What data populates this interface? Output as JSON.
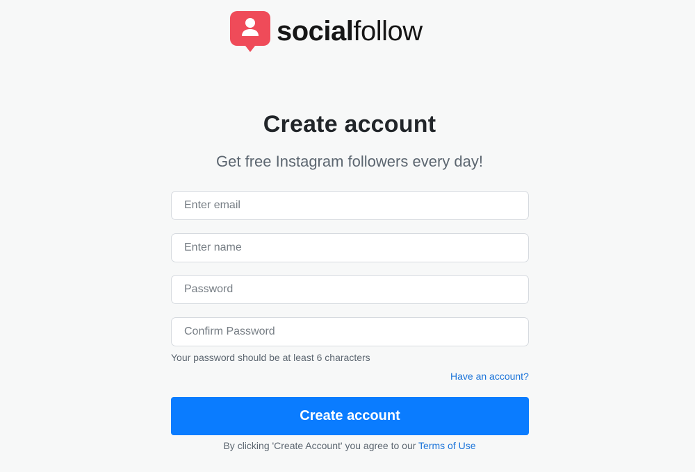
{
  "brand": {
    "name_bold": "social",
    "name_light": "follow",
    "accent_color": "#ef4b59",
    "icon": "user-pin-icon"
  },
  "heading": {
    "title": "Create account",
    "subtitle": "Get free Instagram followers every day!"
  },
  "form": {
    "email_placeholder": "Enter email",
    "name_placeholder": "Enter name",
    "password_placeholder": "Password",
    "confirm_placeholder": "Confirm Password",
    "hint": "Your password should be at least 6 characters",
    "have_account_link": "Have an account?",
    "submit_label": "Create account",
    "button_color": "#0a7cff"
  },
  "footer": {
    "terms_prefix": "By clicking 'Create Account' you agree to our",
    "terms_link": "Terms of Use",
    "link_color": "#1a73d9"
  }
}
